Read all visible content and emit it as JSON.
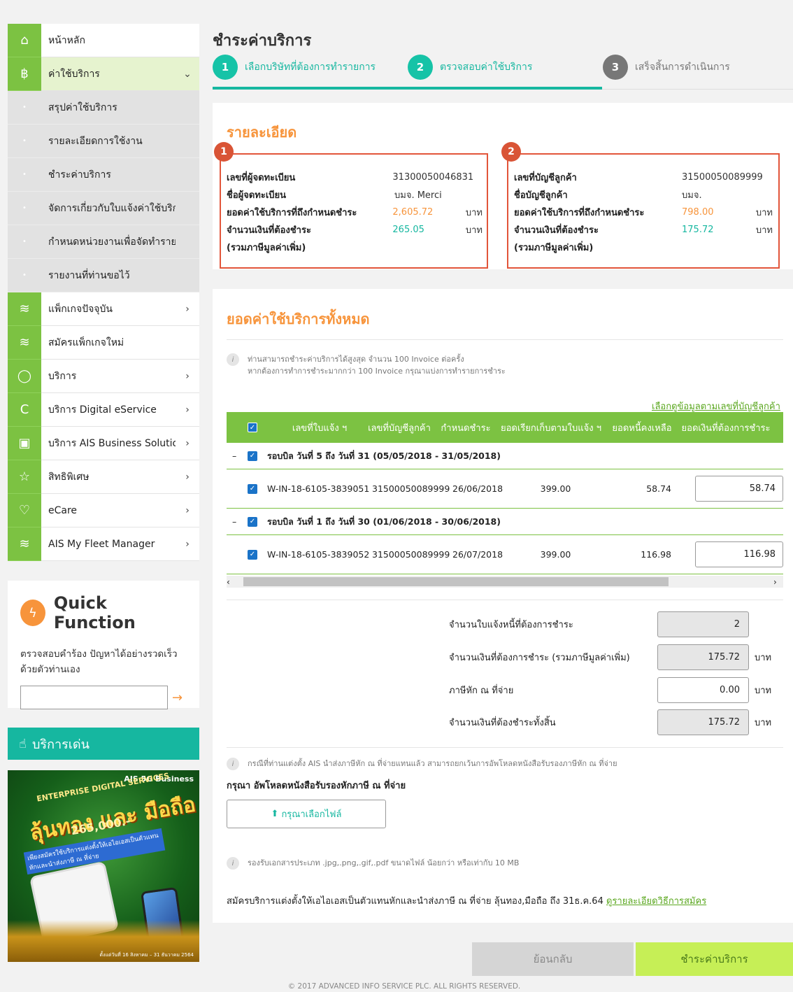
{
  "sidebar": {
    "items": [
      {
        "label": "หน้าหลัก",
        "icon": "home-icon",
        "chev": ""
      },
      {
        "label": "ค่าใช้บริการ",
        "icon": "bill-icon",
        "chev": "⌄"
      },
      {
        "label": "สรุปค่าใช้บริการ",
        "icon": "bullet-icon",
        "chev": ""
      },
      {
        "label": "รายละเอียดการใช้งาน",
        "icon": "bullet-icon",
        "chev": ""
      },
      {
        "label": "ชำระค่าบริการ",
        "icon": "bullet-icon",
        "chev": ""
      },
      {
        "label": "จัดการเกี่ยวกับใบแจ้งค่าใช้บริการ",
        "icon": "bullet-icon",
        "chev": ""
      },
      {
        "label": "กำหนดหน่วยงานเพื่อจัดทำรายงาน",
        "icon": "bullet-icon",
        "chev": ""
      },
      {
        "label": "รายงานที่ท่านขอไว้",
        "icon": "bullet-icon",
        "chev": ""
      },
      {
        "label": "แพ็กเกจปัจจุบัน",
        "icon": "layers-icon",
        "chev": "›"
      },
      {
        "label": "สมัครแพ็กเกจใหม่",
        "icon": "layers-icon",
        "chev": ""
      },
      {
        "label": "บริการ",
        "icon": "refresh-icon",
        "chev": "›"
      },
      {
        "label": "บริการ Digital eService",
        "icon": "eservice-icon",
        "chev": "›"
      },
      {
        "label": "บริการ AIS Business Solutions",
        "icon": "briefcase-icon",
        "chev": "›"
      },
      {
        "label": "สิทธิพิเศษ",
        "icon": "star-icon",
        "chev": "›"
      },
      {
        "label": "eCare",
        "icon": "heart-icon",
        "chev": "›"
      },
      {
        "label": "AIS My Fleet Manager",
        "icon": "layers-icon",
        "chev": "›"
      }
    ]
  },
  "quick_function": {
    "title": "Quick Function",
    "desc": "ตรวจสอบคำร้อง ปัญหาได้อย่างรวดเร็วด้วยตัวท่านเอง",
    "input_value": "",
    "arrow": "→"
  },
  "services_bar": {
    "label": "บริการเด่น"
  },
  "promo": {
    "brand": "AIS 5G Business",
    "line1": "ENTERPRISE DIGITAL SERVICES",
    "line2": "ลุ้นทอง และ มือถือ",
    "line3": "265,000.-",
    "line4": "เพียงสมัครใช้บริการแต่งตั้งให้เอไอเอสเป็นตัวแทนหักและนำส่งภาษี ณ ที่จ่าย",
    "footer": "ตั้งแต่วันที่ 16 สิงหาคม – 31 ธันวาคม 2564"
  },
  "page_title": "ชำระค่าบริการ",
  "steps": [
    {
      "num": "1",
      "label": "เลือกบริษัทที่ต้องการทำรายการ"
    },
    {
      "num": "2",
      "label": "ตรวจสอบค่าใช้บริการ"
    },
    {
      "num": "3",
      "label": "เสร็จสิ้นการดำเนินการ"
    }
  ],
  "details": {
    "title": "รายละเอียด",
    "boxes": [
      {
        "badge": "1",
        "rows": [
          {
            "k": "เลขที่ผู้จดทะเบียน",
            "v": "31300050046831",
            "u": ""
          },
          {
            "k": "ชื่อผู้จดทะเบียน",
            "v": "บมจ. Merci",
            "u": ""
          },
          {
            "k": "ยอดค่าใช้บริการที่ถึงกำหนดชำระ",
            "v": "2,605.72",
            "u": "บาท"
          },
          {
            "k": "จำนวนเงินที่ต้องชำระ",
            "v": "265.05",
            "u": "บาท"
          },
          {
            "k": "(รวมภาษีมูลค่าเพิ่ม)",
            "v": "",
            "u": ""
          }
        ]
      },
      {
        "badge": "2",
        "rows": [
          {
            "k": "เลขที่บัญชีลูกค้า",
            "v": "31500050089999",
            "u": ""
          },
          {
            "k": "ชื่อบัญชีลูกค้า",
            "v": "บมจ.",
            "u": ""
          },
          {
            "k": "ยอดค่าใช้บริการที่ถึงกำหนดชำระ",
            "v": "798.00",
            "u": "บาท"
          },
          {
            "k": "จำนวนเงินที่ต้องชำระ",
            "v": "175.72",
            "u": "บาท"
          },
          {
            "k": "(รวมภาษีมูลค่าเพิ่ม)",
            "v": "",
            "u": ""
          }
        ]
      }
    ]
  },
  "totals": {
    "title": "ยอดค่าใช้บริการทั้งหมด",
    "info1": "ท่านสามารถชำระค่าบริการได้สูงสุด จำนวน 100 Invoice ต่อครั้ง",
    "info2": "หากต้องการทำการชำระมากกว่า 100 Invoice กรุณาแบ่งการทำรายการชำระ",
    "link": "เลือกดูข้อมูลตามเลขที่บัญชีลูกค้า",
    "headers": [
      "เลขที่ใบแจ้ง ฯ",
      "เลขที่บัญชีลูกค้า",
      "กำหนดชำระ",
      "ยอดเรียกเก็บตามใบแจ้ง ฯ",
      "ยอดหนี้คงเหลือ",
      "ยอดเงินที่ต้องการชำระ"
    ],
    "groups": [
      {
        "label": "รอบบิล วันที่ 5 ถึง วันที่ 31 (05/05/2018 - 31/05/2018)",
        "row": {
          "invoice": "W-IN-18-6105-3839051",
          "account": "31500050089999",
          "due": "26/06/2018",
          "billed": "399.00",
          "remaining": "58.74",
          "pay": "58.74"
        }
      },
      {
        "label": "รอบบิล วันที่ 1 ถึง วันที่ 30 (01/06/2018 - 30/06/2018)",
        "row": {
          "invoice": "W-IN-18-6105-3839052",
          "account": "31500050089999",
          "due": "26/07/2018",
          "billed": "399.00",
          "remaining": "116.98",
          "pay": "116.98"
        }
      }
    ],
    "summary": [
      {
        "k": "จำนวนใบแจ้งหนี้ที่ต้องการชำระ",
        "v": "2",
        "u": ""
      },
      {
        "k": "จำนวนเงินที่ต้องการชำระ (รวมภาษีมูลค่าเพิ่ม)",
        "v": "175.72",
        "u": "บาท"
      },
      {
        "k": "ภาษีหัก ณ ที่จ่าย",
        "v": "0.00",
        "u": "บาท"
      },
      {
        "k": "จำนวนเงินที่ต้องชำระทั้งสิ้น",
        "v": "175.72",
        "u": "บาท"
      }
    ],
    "info3": "กรณีที่ท่านแต่งตั้ง AIS นำส่งภาษีหัก ณ ที่จ่ายแทนแล้ว สามารถยกเว้นการอัพโหลดหนังสือรับรองภาษีหัก ณ ที่จ่าย",
    "upload_title": "กรุณา อัพโหลดหนังสือรับรองหักภาษี ณ ที่จ่าย",
    "upload_btn": "กรุณาเลือกไฟล์",
    "info4": "รองรับเอกสารประเภท .jpg,.png,.gif,.pdf ขนาดไฟล์ น้อยกว่า หรือเท่ากับ 10 MB",
    "promo_text": "สมัครบริการแต่งตั้งให้เอไอเอสเป็นตัวแทนหักและนำส่งภาษี ณ ที่จ่าย ลุ้นทอง,มือถือ ถึง 31ธ.ค.64",
    "promo_link": "ดูรายละเอียดวิธีการสมัคร"
  },
  "buttons": {
    "back": "ย้อนกลับ",
    "pay": "ชำระค่าบริการ"
  },
  "footer": "© 2017 ADVANCED INFO SERVICE PLC. ALL RIGHTS RESERVED.",
  "colors": {
    "green": "#7cc242",
    "teal": "#16b7a0",
    "orange": "#f7943b",
    "red": "#e2553a"
  }
}
